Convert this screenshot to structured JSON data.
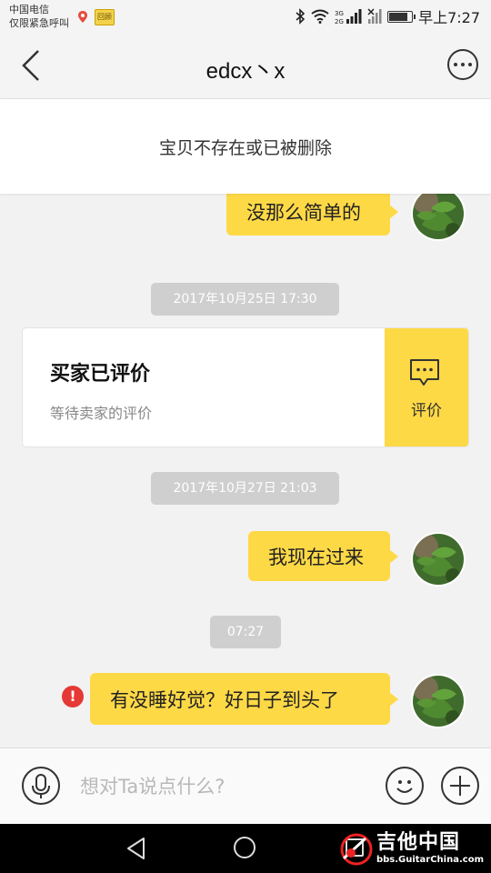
{
  "status_bar": {
    "carrier_line1": "中国电信",
    "carrier_line2": "仅限紧急呼叫",
    "app_badge": "回顾",
    "sim_label": "3G",
    "time": "早上7:27",
    "battery_level": 0.85
  },
  "header": {
    "title": "edcx丶x"
  },
  "notice": {
    "text": "宝贝不存在或已被删除"
  },
  "messages": [
    {
      "text": "没那么简单的"
    },
    {
      "text": "我现在过来"
    },
    {
      "text": "有没睡好觉？好日子到头了"
    }
  ],
  "timestamps": [
    "2017年10月25日 17:30",
    "2017年10月27日 21:03",
    "07:27"
  ],
  "review_card": {
    "title": "买家已评价",
    "subtitle": "等待卖家的评价",
    "action_label": "评价"
  },
  "error_badge": "!",
  "input_bar": {
    "placeholder": "想对Ta说点什么?"
  },
  "watermark": {
    "name": "吉他中国",
    "url": "bbs.GuitarChina.com"
  },
  "icons": {
    "back": "chevron-left-icon",
    "more": "more-icon",
    "voice": "microphone-icon",
    "emoji": "smiley-icon",
    "add": "plus-icon",
    "review": "comment-icon"
  },
  "colors": {
    "bubble": "#fed946",
    "error": "#e53935",
    "timestamp_bg": "#cfcfcf"
  }
}
